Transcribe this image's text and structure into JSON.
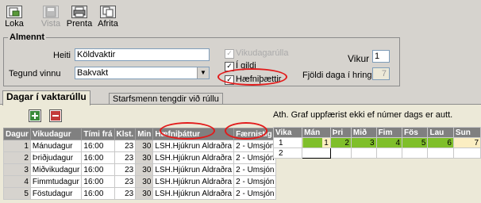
{
  "toolbar": {
    "buttons": [
      {
        "label": "Loka",
        "icon": "close-doc-icon",
        "enabled": true
      },
      {
        "label": "Vista",
        "icon": "save-icon",
        "enabled": false
      },
      {
        "label": "Prenta",
        "icon": "printer-icon",
        "enabled": true
      },
      {
        "label": "Afrita",
        "icon": "copy-icon",
        "enabled": true
      }
    ]
  },
  "general": {
    "legend": "Almennt",
    "name_label": "Heiti",
    "name_value": "Köldvaktir",
    "type_label": "Tegund vinnu",
    "type_value": "Bakvakt",
    "chk_weekday_label": "Vikudagarúlla",
    "chk_valid_label": "Í gildi",
    "chk_competency_label": "Hæfniþættir",
    "weeks_label": "Vikur",
    "weeks_value": "1",
    "days_label": "Fjöldi daga í hring",
    "days_value": "7"
  },
  "tabs": [
    {
      "label": "Dagar í vaktarúllu",
      "active": true
    },
    {
      "label": "Starfsmenn tengdir við rúllu",
      "active": false
    }
  ],
  "left_grid": {
    "headers": [
      "Dagur",
      "Vikudagur",
      "Tími frá",
      "Klst.",
      "Min",
      "Hæfniþáttur",
      "Færnistig"
    ],
    "rows": [
      [
        "1",
        "Mánudagur",
        "16:00",
        "23",
        "30",
        "LSH.Hjúkrun Aldraðra",
        "2 - Umsjón"
      ],
      [
        "2",
        "Þriðjudagur",
        "16:00",
        "23",
        "30",
        "LSH.Hjúkrun Aldraðra",
        "2 - Umsjón"
      ],
      [
        "3",
        "Miðvikudagur",
        "16:00",
        "23",
        "30",
        "LSH.Hjúkrun Aldraðra",
        "2 - Umsjón"
      ],
      [
        "4",
        "Fimmtudagur",
        "16:00",
        "23",
        "30",
        "LSH.Hjúkrun Aldraðra",
        "2 - Umsjón"
      ],
      [
        "5",
        "Föstudagur",
        "16:00",
        "23",
        "30",
        "LSH.Hjúkrun Aldraðra",
        "2 - Umsjón"
      ]
    ]
  },
  "right": {
    "note": "Ath. Graf uppfærist ekki ef númer dags er autt.",
    "headers": [
      "Vika",
      "Mán",
      "Þri",
      "Mið",
      "Fim",
      "Fös",
      "Lau",
      "Sun"
    ],
    "rows": [
      [
        "1",
        "1",
        "2",
        "3",
        "4",
        "5",
        "6",
        "7"
      ],
      [
        "2",
        "",
        "",
        "",
        "",
        "",
        "",
        ""
      ]
    ]
  },
  "colors": {
    "bar": "#7fbf2a",
    "highlight": "#e21b1b"
  }
}
